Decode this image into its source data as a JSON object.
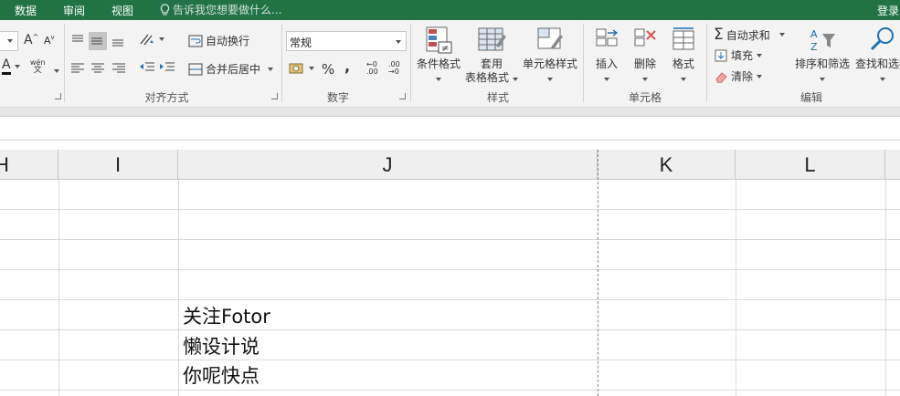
{
  "tabs": {
    "data": "数据",
    "review": "审阅",
    "view": "视图",
    "tell_me": "告诉我您想要做什么...",
    "login": "登录"
  },
  "font_group": {
    "grow_font": "A",
    "shrink_font": "A",
    "font_color": "A",
    "phonetic_top": "wén",
    "phonetic_bottom": "文"
  },
  "alignment_group": {
    "label": "对齐方式",
    "wrap_text": "自动换行",
    "merge_center": "合并后居中"
  },
  "number_group": {
    "label": "数字",
    "format_value": "常规",
    "percent": "%",
    "comma": ",",
    "increase_decimal_top": "←0",
    "increase_decimal_bottom": ".00",
    "decrease_decimal_top": ".00",
    "decrease_decimal_bottom": "→0"
  },
  "styles_group": {
    "label": "样式",
    "conditional_formatting": "条件格式",
    "format_as_table_line1": "套用",
    "format_as_table_line2": "表格格式",
    "cell_styles": "单元格样式"
  },
  "cells_group": {
    "label": "单元格",
    "insert": "插入",
    "delete": "删除",
    "format": "格式"
  },
  "editing_group": {
    "label": "编辑",
    "autosum": "自动求和",
    "fill": "填充",
    "clear": "清除",
    "sort_filter": "排序和筛选",
    "find_select": "查找和选择"
  },
  "columns": [
    "H",
    "I",
    "J",
    "K",
    "L"
  ],
  "cells": {
    "j6": "关注Fotor",
    "j7": "懒设计说",
    "j8": "你呢快点"
  },
  "colors": {
    "accent": "#217346",
    "ribbon_bg": "#f3f3f3",
    "header_bg": "#efefef",
    "gridline": "#dadada"
  }
}
